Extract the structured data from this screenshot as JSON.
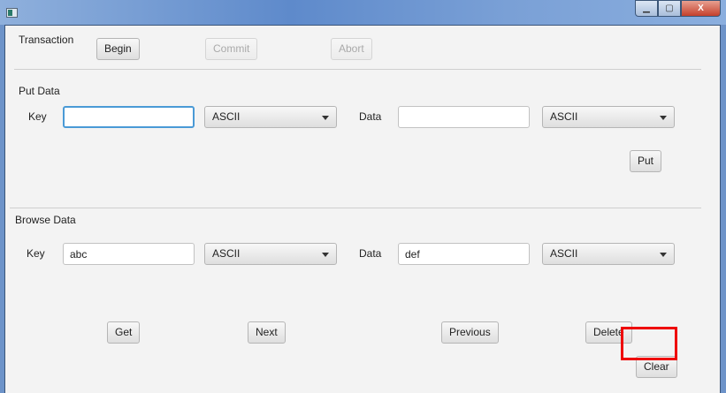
{
  "window": {
    "minimize": "▁",
    "maximize": "▢",
    "close": "X"
  },
  "transaction": {
    "label": "Transaction",
    "begin": "Begin",
    "commit": "Commit",
    "abort": "Abort"
  },
  "put": {
    "title": "Put Data",
    "key_label": "Key",
    "key_value": "",
    "key_encoding": "ASCII",
    "data_label": "Data",
    "data_value": "",
    "data_encoding": "ASCII",
    "put": "Put"
  },
  "browse": {
    "title": "Browse Data",
    "key_label": "Key",
    "key_value": "abc",
    "key_encoding": "ASCII",
    "data_label": "Data",
    "data_value": "def",
    "data_encoding": "ASCII",
    "get": "Get",
    "next": "Next",
    "previous": "Previous",
    "delete": "Delete",
    "clear": "Clear"
  }
}
